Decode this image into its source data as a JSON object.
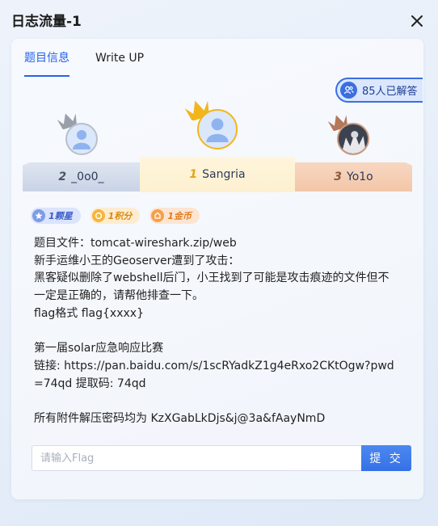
{
  "dialog": {
    "title": "日志流量-1",
    "close_icon": "close-icon"
  },
  "tabs": [
    {
      "label": "题目信息",
      "active": true
    },
    {
      "label": "Write UP",
      "active": false
    }
  ],
  "solved": {
    "icon": "users-icon",
    "text": "85人已解答"
  },
  "podium": {
    "first": {
      "rank": "1",
      "name": "Sangria",
      "medal_color": "#f2b61c",
      "icon": "crown-icon"
    },
    "second": {
      "rank": "2",
      "name": "_0o0_",
      "medal_color": "#9aa0aa",
      "icon": "crown-icon"
    },
    "third": {
      "rank": "3",
      "name": "Yo1o",
      "medal_color": "#b4785a",
      "icon": "crown-icon"
    }
  },
  "tags": [
    {
      "label": "1颗星",
      "icon": "star-icon"
    },
    {
      "label": "1积分",
      "icon": "points-icon"
    },
    {
      "label": "1金币",
      "icon": "coin-icon"
    }
  ],
  "description": [
    "题目文件：tomcat-wireshark.zip/web",
    "新手运维小王的Geoserver遭到了攻击：",
    "黑客疑似删除了webshell后门，小王找到了可能是攻击痕迹的文件但不一定是正确的，请帮他排查一下。",
    "flag格式 flag{xxxx}",
    "",
    "第一届solar应急响应比赛",
    "链接: https://pan.baidu.com/s/1scRYadkZ1g4eRxo2CKtOgw?pwd=74qd 提取码: 74qd",
    "",
    "所有附件解压密码均为 KzXGabLkDjs&j@3a&fAayNmD"
  ],
  "flag_form": {
    "placeholder": "请输入Flag",
    "value": "",
    "submit_label": "提 交"
  },
  "colors": {
    "accent": "#2563eb",
    "gold": "#f2b61c",
    "silver": "#9aa0aa",
    "bronze": "#b4785a"
  }
}
